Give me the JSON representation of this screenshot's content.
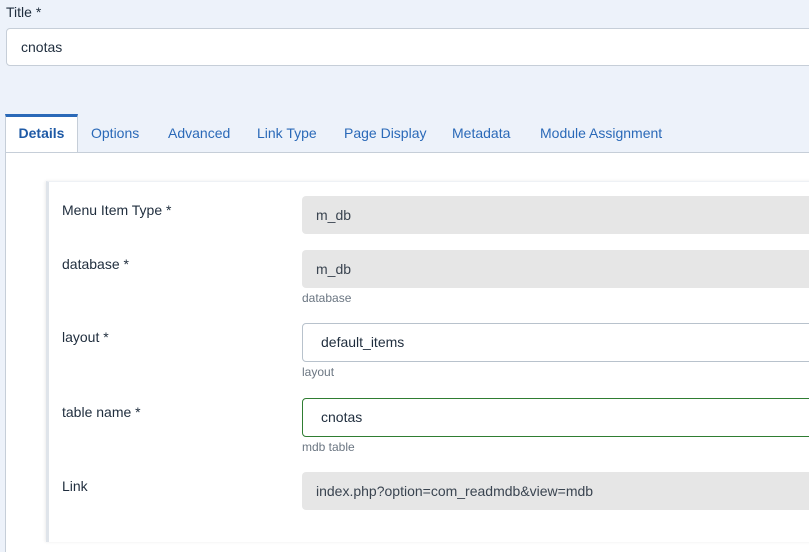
{
  "title_field": {
    "label": "Title *",
    "value": "cnotas"
  },
  "tabs": [
    {
      "label": "Details",
      "active": true
    },
    {
      "label": "Options"
    },
    {
      "label": "Advanced"
    },
    {
      "label": "Link Type"
    },
    {
      "label": "Page Display"
    },
    {
      "label": "Metadata"
    },
    {
      "label": "Module Assignment"
    }
  ],
  "fields": {
    "menu_item_type": {
      "label": "Menu Item Type *",
      "value": "m_db"
    },
    "database": {
      "label": "database *",
      "value": "m_db",
      "help": "database"
    },
    "layout": {
      "label": "layout *",
      "value": "default_items",
      "help": "layout"
    },
    "table_name": {
      "label": "table name *",
      "value": "cnotas",
      "help": "mdb table"
    },
    "link": {
      "label": "Link",
      "value": "index.php?option=com_readmdb&view=mdb"
    }
  },
  "colors": {
    "accent": "#2a69b8",
    "background": "#edf2fa",
    "valid_border": "#2f7d32",
    "readonly_bg": "#e6e6e6"
  }
}
